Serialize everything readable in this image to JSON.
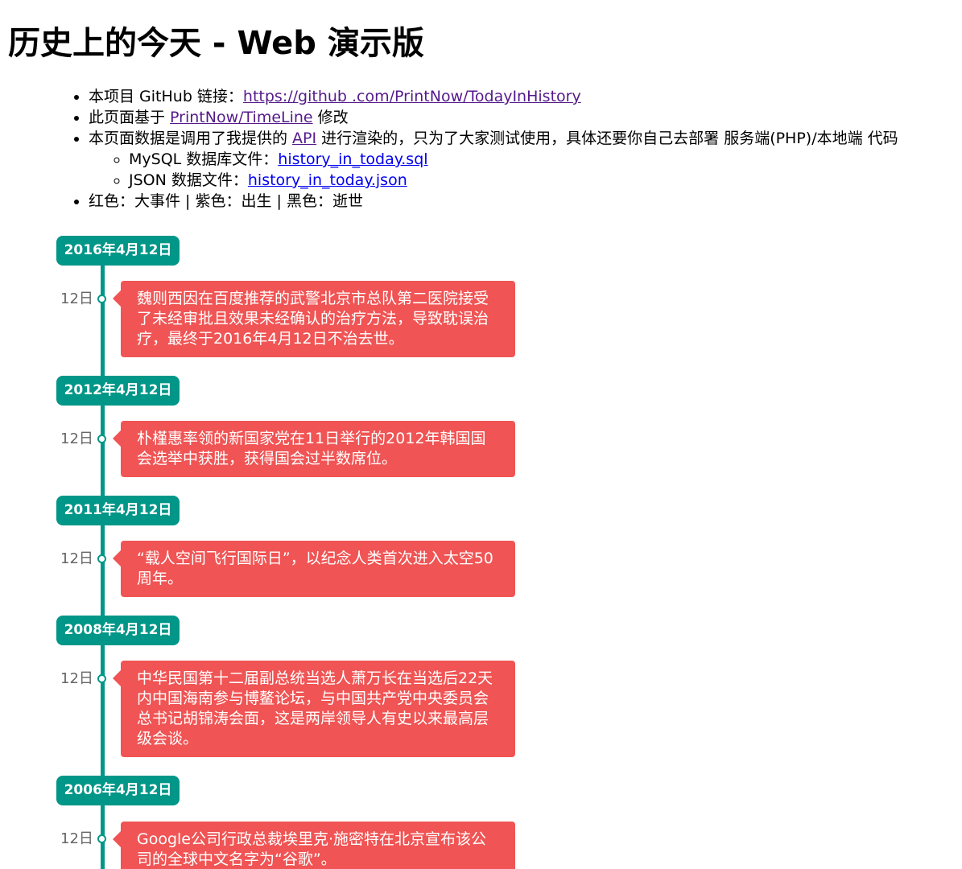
{
  "page": {
    "title": "历史上的今天 - Web 演示版"
  },
  "info": {
    "github_prefix": "本项目 GitHub 链接：",
    "github_link": "https://github .com/PrintNow/TodayInHistory",
    "based_prefix": "此页面基于 ",
    "based_link": "PrintNow/TimeLine",
    "based_suffix": " 修改",
    "api_prefix": "本页面数据是调用了我提供的 ",
    "api_link": "API",
    "api_suffix": " 进行渲染的，只为了大家测试使用，具体还要你自己去部署 服务端(PHP)/本地端 代码",
    "mysql_prefix": "MySQL 数据库文件：",
    "mysql_link": "history_in_today.sql",
    "json_prefix": "JSON 数据文件：",
    "json_link": "history_in_today.json",
    "legend": "红色：大事件 | 紫色：出生 | 黑色：逝世"
  },
  "colors": {
    "timeline": "#009688",
    "event_major": "#f05454"
  },
  "timeline": [
    {
      "date": "2016年4月12日",
      "day": "12日",
      "text": "魏则西因在百度推荐的武警北京市总队第二医院接受了未经审批且效果未经确认的治疗方法，导致耽误治疗，最终于2016年4月12日不治去世。"
    },
    {
      "date": "2012年4月12日",
      "day": "12日",
      "text": "朴槿惠率领的新国家党在11日举行的2012年韩国国会选举中获胜，获得国会过半数席位。"
    },
    {
      "date": "2011年4月12日",
      "day": "12日",
      "text": "“载人空间飞行国际日”，以纪念人类首次进入太空50周年。"
    },
    {
      "date": "2008年4月12日",
      "day": "12日",
      "text": "中华民国第十二届副总统当选人萧万长在当选后22天内中国海南参与博鳌论坛，与中国共产党中央委员会总书记胡锦涛会面，这是两岸领导人有史以来最高层级会谈。"
    },
    {
      "date": "2006年4月12日",
      "day": "12日",
      "text": "Google公司行政总裁埃里克·施密特在北京宣布该公司的全球中文名字为“谷歌”。"
    }
  ]
}
